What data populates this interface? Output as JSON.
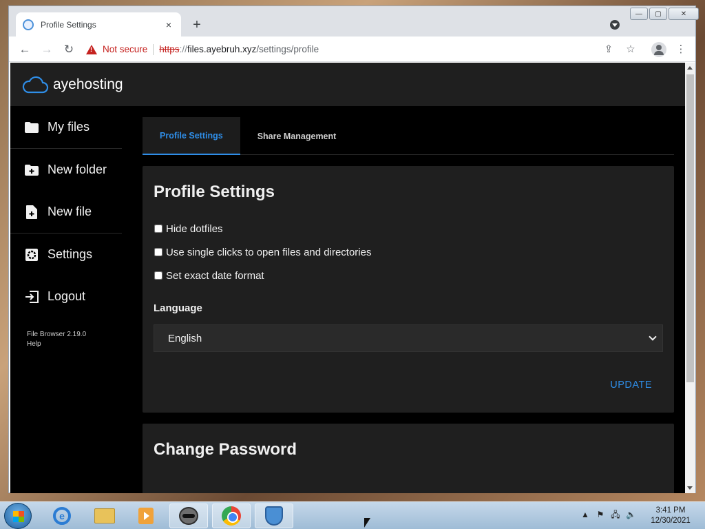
{
  "browser": {
    "tab_title": "Profile Settings",
    "tab_close": "×",
    "new_tab": "+",
    "not_secure": "Not secure",
    "url_scheme": "https",
    "url_scheme_sep": "://",
    "url_host": "files.ayebruh.xyz",
    "url_path": "/settings/profile",
    "win_min": "—",
    "win_max": "▢",
    "win_close": "✕"
  },
  "nav": {
    "back": "←",
    "forward": "→",
    "reload": "↻",
    "share": "⇪",
    "star": "☆",
    "menu": "⋮"
  },
  "app": {
    "brand": "ayehosting"
  },
  "sidebar": {
    "items": [
      {
        "label": "My files",
        "icon": "folder-icon"
      },
      {
        "label": "New folder",
        "icon": "folder-plus-icon"
      },
      {
        "label": "New file",
        "icon": "file-plus-icon"
      },
      {
        "label": "Settings",
        "icon": "gear-icon"
      },
      {
        "label": "Logout",
        "icon": "logout-icon"
      }
    ],
    "version": "File Browser 2.19.0",
    "help": "Help"
  },
  "settings": {
    "tabs": [
      {
        "label": "Profile Settings",
        "active": true
      },
      {
        "label": "Share Management",
        "active": false
      }
    ],
    "profile_title": "Profile Settings",
    "checkboxes": [
      {
        "label": "Hide dotfiles",
        "checked": false
      },
      {
        "label": "Use single clicks to open files and directories",
        "checked": false
      },
      {
        "label": "Set exact date format",
        "checked": false
      }
    ],
    "language_label": "Language",
    "language_value": "English",
    "update_label": "UPDATE",
    "password_title": "Change Password"
  },
  "taskbar": {
    "time": "3:41 PM",
    "date": "12/30/2021",
    "ie_letter": "e",
    "tray_up": "▲",
    "tray_flag": "⚑",
    "tray_net": "🖧",
    "tray_sound": "🔈"
  },
  "colors": {
    "accent": "#2f8ee8",
    "page_bg": "#000000",
    "card_bg": "#1f1f1f",
    "header_bg": "#1f1f1f",
    "not_secure": "#c5221f"
  }
}
